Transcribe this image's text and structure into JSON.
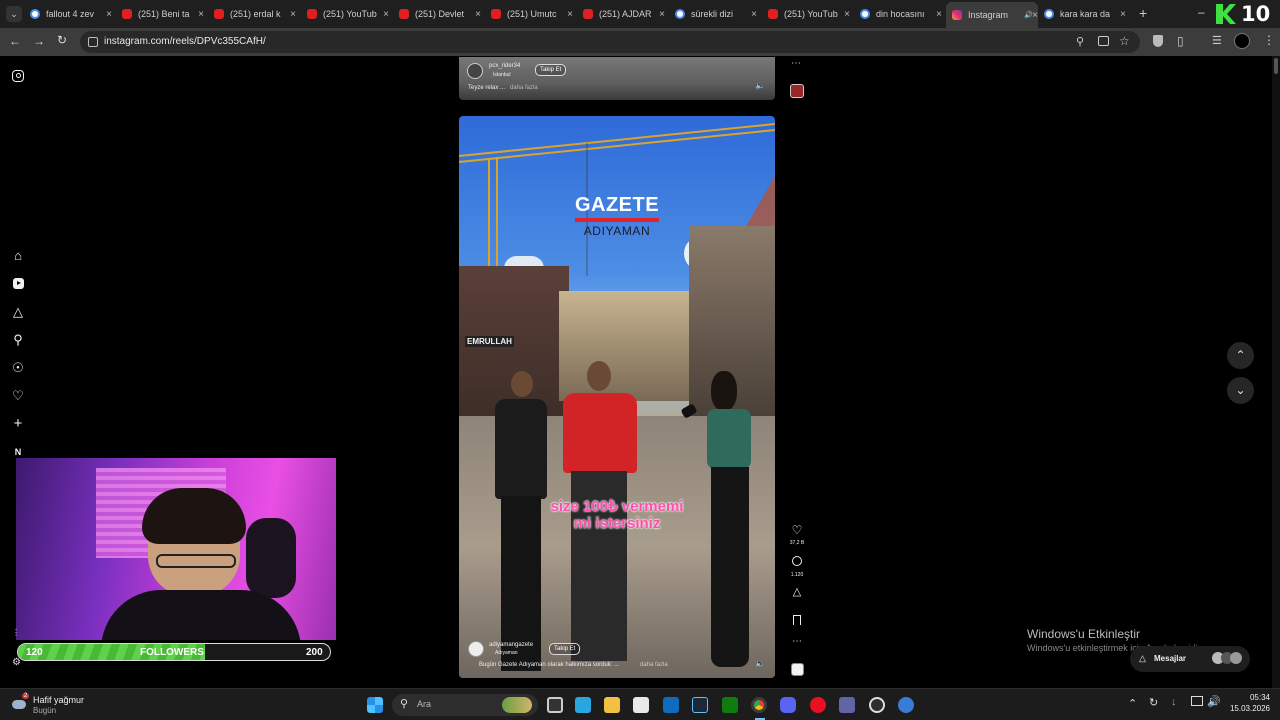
{
  "browser": {
    "tabs": [
      {
        "title": "fallout 4 zev",
        "icon": "google-icon",
        "active": false
      },
      {
        "title": "(251) Beni ta",
        "icon": "youtube-icon",
        "active": false
      },
      {
        "title": "(251) erdal k",
        "icon": "youtube-icon",
        "active": false
      },
      {
        "title": "(251) YouTub",
        "icon": "youtube-icon",
        "active": false
      },
      {
        "title": "(251) Devlet",
        "icon": "youtube-icon",
        "active": false
      },
      {
        "title": "(251) Umutc",
        "icon": "youtube-icon",
        "active": false
      },
      {
        "title": "(251) AJDAR",
        "icon": "youtube-icon",
        "active": false
      },
      {
        "title": "sürekli dizi",
        "icon": "google-icon",
        "active": false
      },
      {
        "title": "(251) YouTub",
        "icon": "youtube-icon",
        "active": false
      },
      {
        "title": "din hocasını",
        "icon": "google-icon",
        "active": false
      },
      {
        "title": "Instagram",
        "icon": "instagram-icon",
        "active": true
      },
      {
        "title": "kara kara da",
        "icon": "google-icon",
        "active": false
      }
    ],
    "new_tab": "+",
    "url": "instagram.com/reels/DPVc355CAfH/"
  },
  "overlay": {
    "counter_logo": "10",
    "followers": {
      "label": "FOLLOWERS",
      "current": "120",
      "goal": "200",
      "progress": 0.6
    }
  },
  "reels": {
    "previous": {
      "username": "pcx_rider34",
      "location": "İstanbul",
      "follow_label": "Takip Et",
      "caption": "Teyze relax ...",
      "more": "daha fazla"
    },
    "current": {
      "brand_top": "GAZETE",
      "brand_bottom": "ADIYAMAN",
      "subtitle_line1": "size 100₺ vermemi",
      "subtitle_line2": "mi istersiniz",
      "shop_sign": "EMRULLAH",
      "username": "adiyamangazete",
      "location": "Adıyaman",
      "follow_label": "Takip Et",
      "caption": "Bugün Gazete Adıyaman olarak halkımıza sorduk: ...",
      "more": "daha fazla",
      "likes": "37,2 B",
      "comments": "1.120"
    }
  },
  "windows": {
    "activate_title": "Windows'u Etkinleştir",
    "activate_sub": "Windows'u etkinleştirmek için Ayarlar'a gidin.",
    "messages_label": "Mesajlar",
    "weather_title": "Hafif yağmur",
    "weather_sub": "Bugün",
    "weather_badge": "2",
    "search_placeholder": "Ara",
    "time": "05:34",
    "date": "15.03.2026"
  },
  "colors": {
    "accent_green": "#5fd14a",
    "gazete_red": "#e2232a",
    "subtitle_pink": "#ff4fae"
  }
}
